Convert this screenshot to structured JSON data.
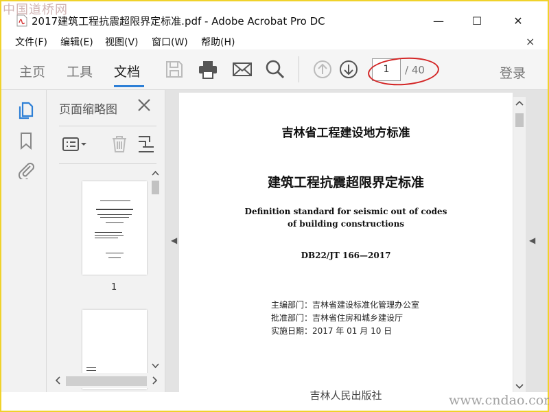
{
  "window": {
    "title": "2017建筑工程抗震超限界定标准.pdf - Adobe Acrobat Pro DC",
    "minimize": "—",
    "maximize": "☐",
    "close": "✕"
  },
  "watermark": {
    "top": "中国道桥网",
    "bottom": "www.cndao.com"
  },
  "menu": {
    "items": [
      "文件(F)",
      "编辑(E)",
      "视图(V)",
      "窗口(W)",
      "帮助(H)"
    ],
    "close": "×"
  },
  "toolbar": {
    "tabs": [
      "主页",
      "工具",
      "文档"
    ],
    "active_tab": "文档",
    "accent_color": "#2d7fd6",
    "icons": [
      "save-icon",
      "print-icon",
      "email-icon",
      "search-icon",
      "page-up-icon",
      "page-down-icon"
    ],
    "page_current": "1",
    "page_total": "/ 40",
    "login": "登录"
  },
  "rail": {
    "icons": [
      "page-thumbnails-icon",
      "bookmark-icon",
      "attachment-icon"
    ]
  },
  "thumbnail_panel": {
    "title": "页面缩略图",
    "close": "×",
    "tools": [
      "options-menu-icon",
      "delete-icon",
      "crop-icon"
    ],
    "pages": [
      {
        "label": "1"
      }
    ]
  },
  "document": {
    "org": "吉林省工程建设地方标准",
    "title": "建筑工程抗震超限界定标准",
    "en_title_line1": "Definition standard for seismic out of codes",
    "en_title_line2": "of building constructions",
    "code": "DB22/JT 166—2017",
    "info": [
      "主编部门：吉林省建设标准化管理办公室",
      "批准部门：吉林省住房和城乡建设厅",
      "实施日期：2017 年 01 月 10 日"
    ],
    "publisher_partial": "吉林人民出版社"
  }
}
